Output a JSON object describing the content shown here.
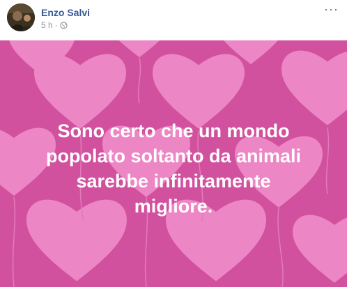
{
  "post": {
    "author": "Enzo Salvi",
    "timestamp": "5 h",
    "separator": "·",
    "privacy_icon": "globe-icon",
    "more_icon": "more-options-icon",
    "more_label": "···",
    "avatar_icon": "profile-photo",
    "text_lines": [
      "Sono certo che un mondo",
      "popolato soltanto da animali",
      "sarebbe infinitamente",
      "migliore."
    ],
    "background": "hearts-pattern",
    "colors": {
      "author": "#365899",
      "meta": "#90949c",
      "background": "#d2519f",
      "hearts": "#ef8cc8",
      "text": "#ffffff"
    }
  }
}
